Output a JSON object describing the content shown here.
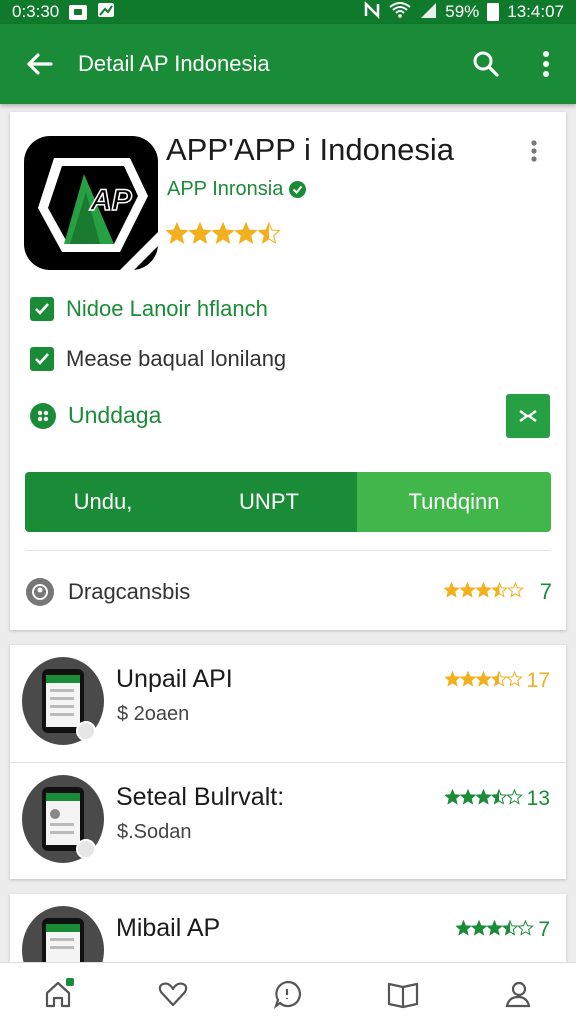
{
  "colors": {
    "primary": "#1a8c37",
    "primary_dark": "#0f7a2c",
    "accent_light": "#41b64a",
    "star_gold": "#f2b01e",
    "star_green": "#1a8c37"
  },
  "status_bar": {
    "time_left": "0:3:30",
    "battery_percent": "59%",
    "time_right": "13:4:07"
  },
  "app_bar": {
    "title": "Detail AP Indonesia",
    "icons": [
      "arrow-back-icon",
      "search-icon",
      "more-vert-icon"
    ]
  },
  "app": {
    "name": "APP'APP i Indonesia",
    "logo_text": "AP",
    "developer": "APP Inronsia",
    "rating_stars": 4.5,
    "features": [
      {
        "label": "Nidoe Lanoir hflanch",
        "icon": "check-icon"
      },
      {
        "label": "Mease baqual lonilang",
        "icon": "check-icon"
      }
    ],
    "download": {
      "label": "Unddaga",
      "icon": "download-icon"
    },
    "tabs": [
      "Undu,",
      "UNPT",
      "Tundqinn"
    ],
    "review": {
      "label": "Dragcansbis",
      "rating_stars": 3.5,
      "count": "7"
    }
  },
  "related": [
    {
      "title": "Unpail API",
      "price": "$ 2oaen",
      "rating_stars": 3.5,
      "count": "17",
      "star_color": "gold"
    },
    {
      "title": "Seteal Bulrvalt:",
      "price": "$.Sodan",
      "rating_stars": 3.5,
      "count": "13",
      "star_color": "green"
    },
    {
      "title": "Mibail AP",
      "price": "",
      "rating_stars": 3.5,
      "count": "7",
      "star_color": "green"
    }
  ],
  "bottom_nav": [
    "home-icon",
    "wishlist-icon",
    "chat-icon",
    "library-icon",
    "account-icon"
  ]
}
